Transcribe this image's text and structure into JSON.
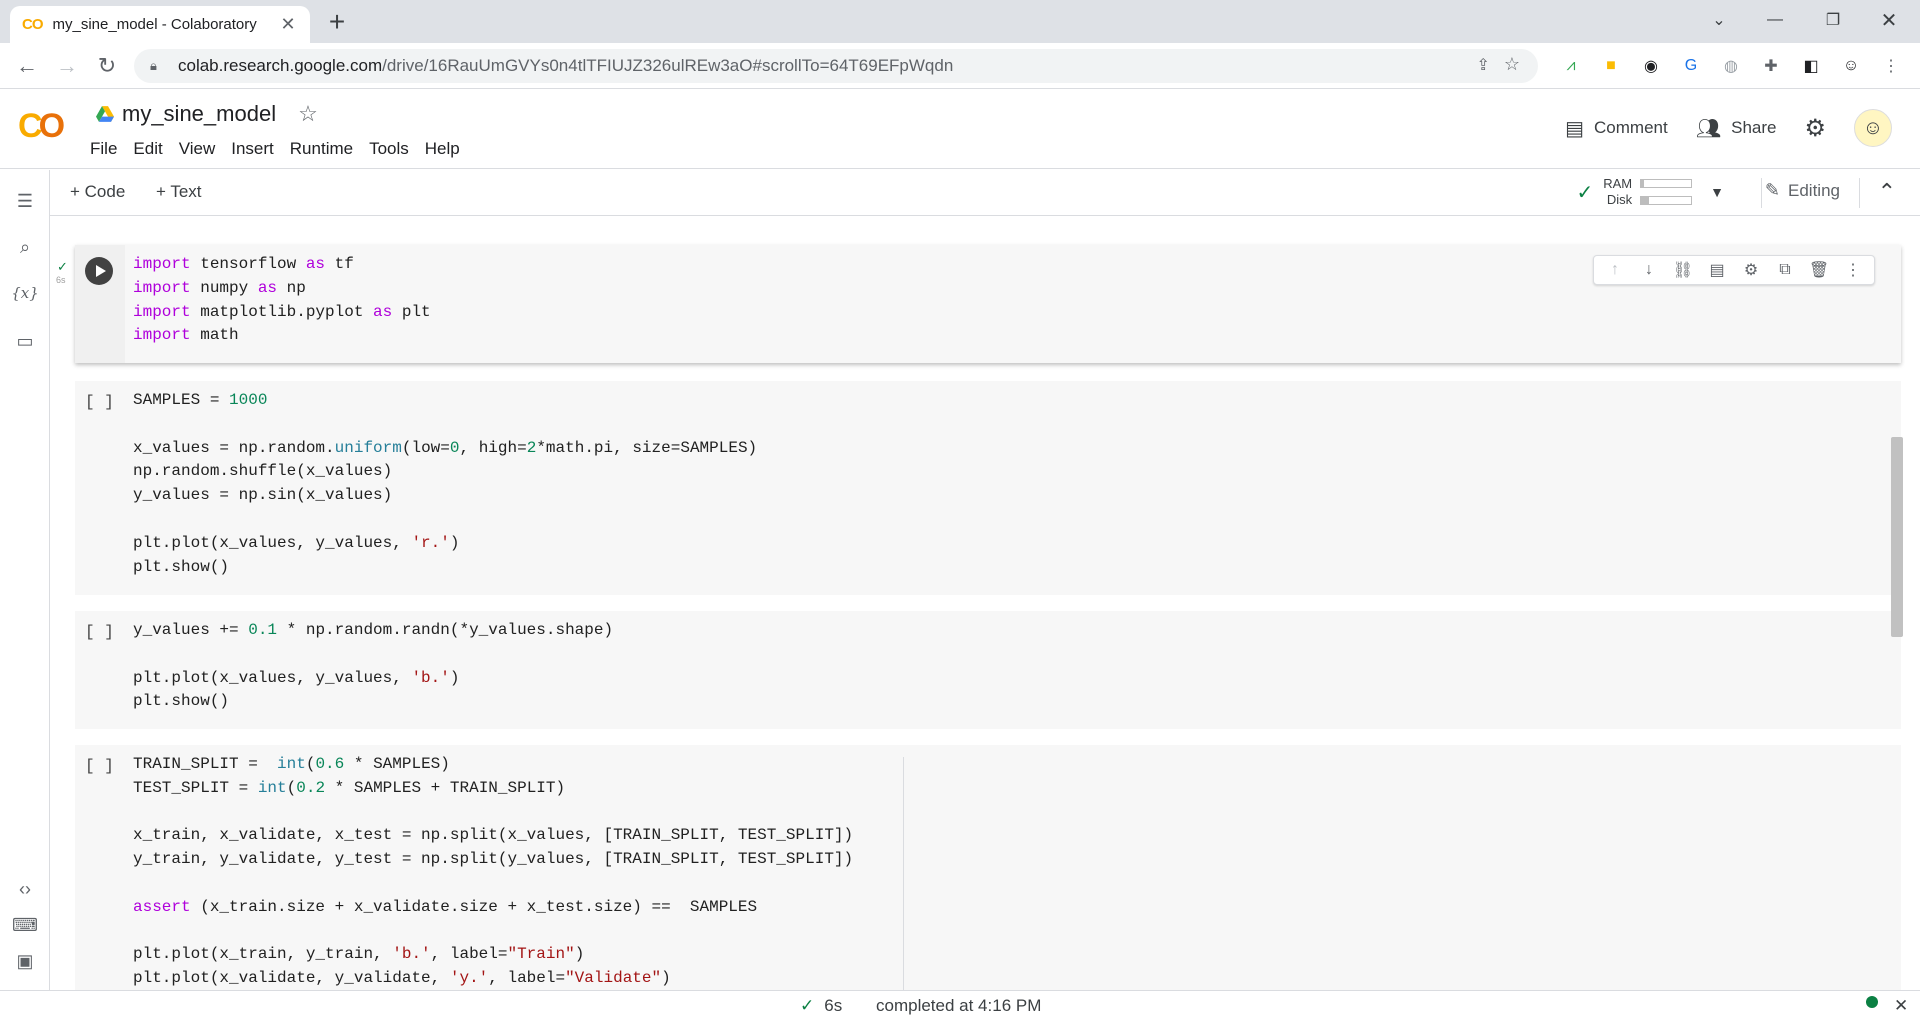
{
  "browser": {
    "tab_title": "my_sine_model - Colaboratory",
    "tab_icon_text": "CO",
    "url_host": "colab.research.google.com",
    "url_rest": "/drive/16RauUmGVYs0n4tlTFIUJZ326ulREw3aO#scrollTo=64T69EFpWqdn"
  },
  "colab": {
    "logo": "CO",
    "doc_title": "my_sine_model",
    "menu": [
      "File",
      "Edit",
      "View",
      "Insert",
      "Runtime",
      "Tools",
      "Help"
    ],
    "comment_label": "Comment",
    "share_label": "Share"
  },
  "toolbar": {
    "add_code": "+ Code",
    "add_text": "+ Text",
    "ram_label": "RAM",
    "disk_label": "Disk",
    "ram_fraction": 0.05,
    "disk_fraction": 0.15,
    "editing_label": "Editing"
  },
  "cells": [
    {
      "status_time": "6s",
      "bracket": "[ ]",
      "lines": [
        "import tensorflow as tf",
        "import numpy as np",
        "import matplotlib.pyplot as plt",
        "import math"
      ]
    },
    {
      "bracket": "[ ]",
      "lines": [
        "SAMPLES = 1000",
        "",
        "x_values = np.random.uniform(low=0, high=2*math.pi, size=SAMPLES)",
        "np.random.shuffle(x_values)",
        "y_values = np.sin(x_values)",
        "",
        "plt.plot(x_values, y_values, 'r.')",
        "plt.show()"
      ]
    },
    {
      "bracket": "[ ]",
      "lines": [
        "y_values += 0.1 * np.random.randn(*y_values.shape)",
        "",
        "plt.plot(x_values, y_values, 'b.')",
        "plt.show()"
      ]
    },
    {
      "bracket": "[ ]",
      "lines": [
        "TRAIN_SPLIT =  int(0.6 * SAMPLES)",
        "TEST_SPLIT = int(0.2 * SAMPLES + TRAIN_SPLIT)",
        "",
        "x_train, x_validate, x_test = np.split(x_values, [TRAIN_SPLIT, TEST_SPLIT])",
        "y_train, y_validate, y_test = np.split(y_values, [TRAIN_SPLIT, TEST_SPLIT])",
        "",
        "assert (x_train.size + x_validate.size + x_test.size) ==  SAMPLES",
        "",
        "plt.plot(x_train, y_train, 'b.', label=\"Train\")",
        "plt.plot(x_validate, y_validate, 'y.', label=\"Validate\")"
      ]
    }
  ],
  "statusbar": {
    "exec_time": "6s",
    "completed_text": "completed at 4:16 PM"
  },
  "colors": {
    "colab_orange": "#f9ab00",
    "keyword": "#af00db",
    "number": "#098658",
    "string": "#a31515",
    "ok_green": "#0b8043"
  }
}
